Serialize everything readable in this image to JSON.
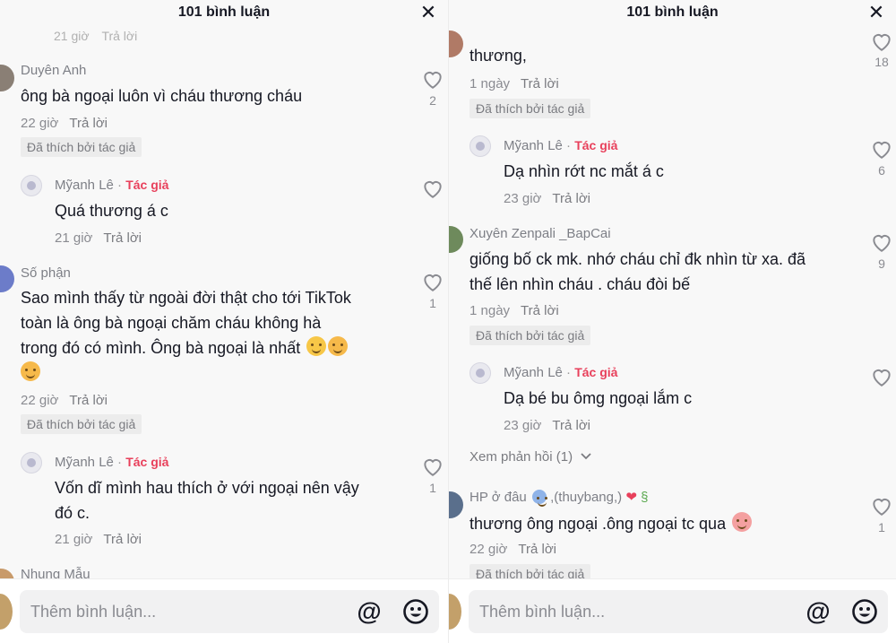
{
  "left": {
    "header": {
      "title": "101 bình luận",
      "close": "✕"
    },
    "partial_top_meta": {
      "time": "21 giờ",
      "reply": "Trả lời"
    },
    "comments": [
      {
        "user": "Duyên Anh",
        "text": "ông bà ngoại luôn vì cháu thương cháu",
        "time": "22 giờ",
        "reply": "Trả lời",
        "liked_badge": "Đã thích bởi tác giả",
        "likes": "2"
      },
      {
        "user": "Mỹanh Lê",
        "author_sep": "·",
        "author_tag": "Tác giả",
        "text": "Quá thương á c",
        "time": "21 giờ",
        "reply": "Trả lời"
      },
      {
        "user": "Số phận",
        "text_lines": [
          "Sao mình thấy từ ngoài đời thật cho tới TikTok",
          "toàn là ông bà ngoại chăm cháu không hà",
          "trong đó có mình. Ông bà ngoại là nhất"
        ],
        "time": "22 giờ",
        "reply": "Trả lời",
        "liked_badge": "Đã thích bởi tác giả",
        "likes": "1"
      },
      {
        "user": "Mỹanh Lê",
        "author_sep": "·",
        "author_tag": "Tác giả",
        "text_lines": [
          "Vốn dĩ mình hau thích ở với ngoại nên vậy",
          "đó c."
        ],
        "time": "21 giờ",
        "reply": "Trả lời",
        "likes": "1"
      },
      {
        "user": "Nhung Mẫu"
      }
    ],
    "footer": {
      "placeholder": "Thêm bình luận...",
      "mention": "@"
    }
  },
  "right": {
    "header": {
      "title": "101 bình luận",
      "close": "✕"
    },
    "comments": [
      {
        "text": "thương,",
        "time": "1 ngày",
        "reply": "Trả lời",
        "liked_badge": "Đã thích bởi tác giả",
        "likes": "18"
      },
      {
        "user": "Mỹanh Lê",
        "author_sep": "·",
        "author_tag": "Tác giả",
        "text": "Dạ nhìn rớt nc mắt á c",
        "time": "23 giờ",
        "reply": "Trả lời",
        "likes": "6"
      },
      {
        "user": "Xuyên Zenpali _BapCai",
        "text_lines": [
          "giống bố ck mk. nhớ cháu chỉ đk nhìn từ xa. đã",
          "thế lên nhìn cháu . cháu đòi bế"
        ],
        "time": "1 ngày",
        "reply": "Trả lời",
        "liked_badge": "Đã thích bởi tác giả",
        "likes": "9"
      },
      {
        "user": "Mỹanh Lê",
        "author_sep": "·",
        "author_tag": "Tác giả",
        "text": "Dạ bé bu ômg ngoại lắm c",
        "time": "23 giờ",
        "reply": "Trả lời",
        "view_replies": "Xem phản hồi (1)"
      },
      {
        "user": "HP ở đâu",
        "user_suffix": ",(thuybang,)",
        "text": "thương ông ngoại .ông ngoại tc qua",
        "time": "22 giờ",
        "reply": "Trả lời",
        "liked_badge": "Đã thích bởi tác giả",
        "likes": "1"
      }
    ],
    "footer": {
      "placeholder": "Thêm bình luận...",
      "mention": "@"
    }
  },
  "colors": {
    "author_tag": "#e8405b",
    "text": "#161823",
    "meta": "#8a8b91",
    "background": "#f8f8f8"
  },
  "icons": [
    "close-icon",
    "heart-icon",
    "emoji-icon",
    "chevron-down-icon",
    "mention-icon"
  ]
}
